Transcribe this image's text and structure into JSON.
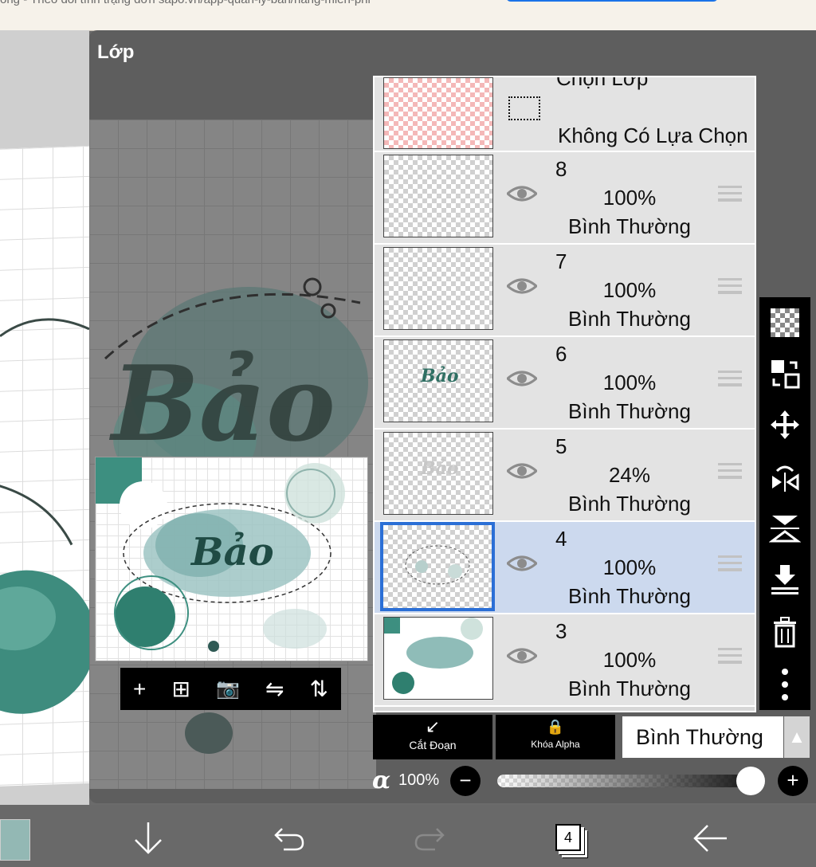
{
  "browser": {
    "url_text": "ong - Theo dõi tình trạng đơn sapo.vn/app-quan-ly-ban/hang-mien-phi"
  },
  "panel": {
    "title": "Lớp"
  },
  "canvas": {
    "art_text": "Bảo"
  },
  "thumbnail_toolbar": {
    "icons": [
      "plus-icon",
      "add-layer-icon",
      "camera-icon",
      "flip-horizontal-icon",
      "flip-vertical-icon"
    ],
    "glyphs": [
      "+",
      "⊞",
      "📷",
      "⇋",
      "⇅"
    ]
  },
  "selection_layer": {
    "title": "Chọn Lớp",
    "subtitle": "Không Có Lựa Chọn"
  },
  "layers": [
    {
      "number": "8",
      "opacity": "100%",
      "mode": "Bình Thường",
      "selected": false,
      "visible": true
    },
    {
      "number": "7",
      "opacity": "100%",
      "mode": "Bình Thường",
      "selected": false,
      "visible": true
    },
    {
      "number": "6",
      "opacity": "100%",
      "mode": "Bình Thường",
      "selected": false,
      "visible": true,
      "thumb_text": "Bảo"
    },
    {
      "number": "5",
      "opacity": "24%",
      "mode": "Bình Thường",
      "selected": false,
      "visible": true,
      "thumb_text": "Bảo"
    },
    {
      "number": "4",
      "opacity": "100%",
      "mode": "Bình Thường",
      "selected": true,
      "visible": true
    },
    {
      "number": "3",
      "opacity": "100%",
      "mode": "Bình Thường",
      "selected": false,
      "visible": true
    }
  ],
  "right_tools": {
    "icons": [
      "transparency-icon",
      "layer-swap-icon",
      "move-icon",
      "flip-horizontal-icon",
      "flip-vertical-icon",
      "merge-down-icon",
      "trash-icon",
      "more-icon"
    ]
  },
  "controls": {
    "clip_label": "Cắt Đoạn",
    "alpha_lock_label": "Khóa Alpha",
    "blend_mode": "Bình Thường",
    "alpha_symbol": "α",
    "alpha_value": "100%",
    "opacity_fraction": 1.0
  },
  "bottom_nav": {
    "layer_count": "4",
    "icons": [
      "down-arrow-icon",
      "undo-icon",
      "redo-icon",
      "layers-icon",
      "back-arrow-icon"
    ]
  },
  "colors": {
    "selected_layer_bg": "#ccd9ee",
    "selected_border": "#2b6fd6",
    "teal_art": "#3d8f80",
    "primary_color": "#93b8b4"
  }
}
